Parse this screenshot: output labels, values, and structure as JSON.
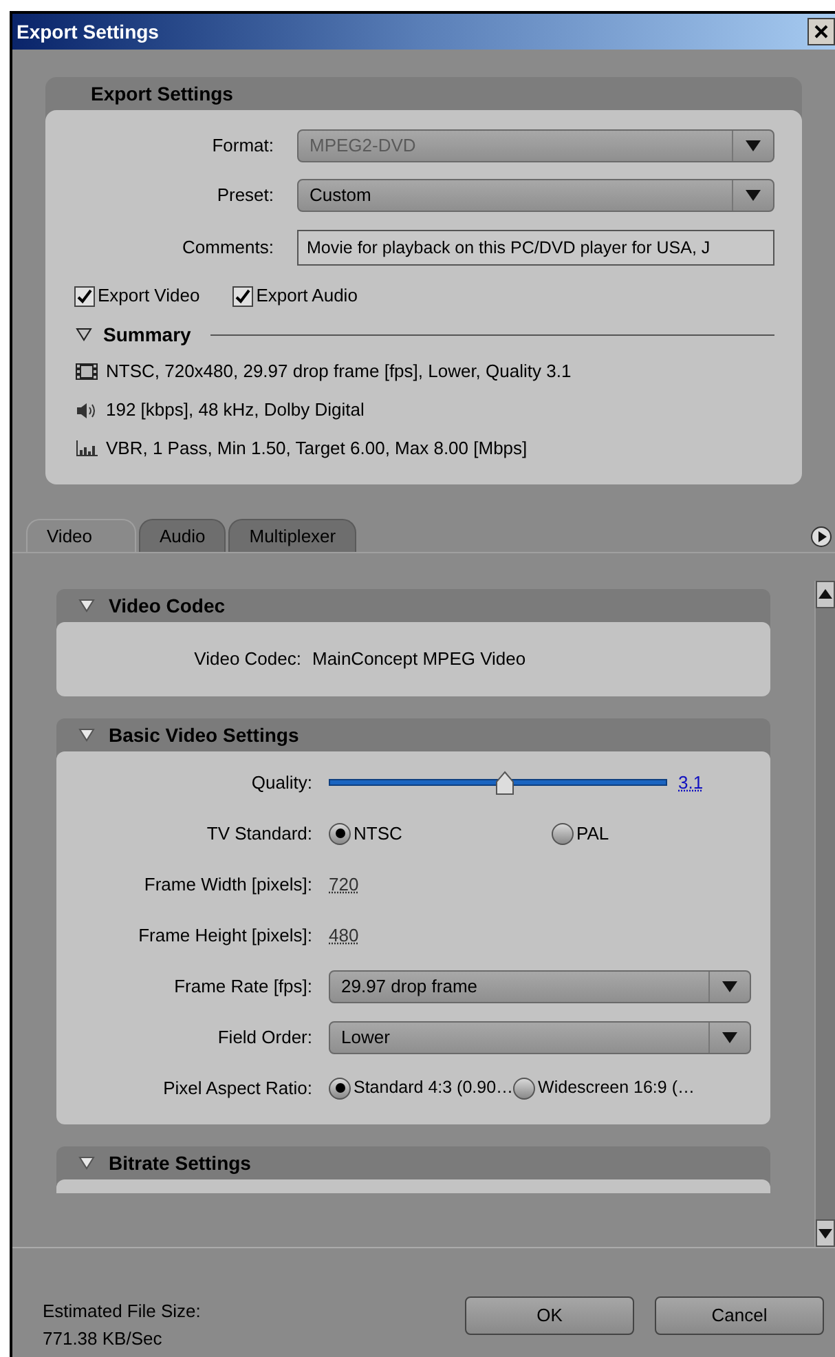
{
  "window": {
    "title": "Export Settings"
  },
  "export_settings": {
    "title": "Export Settings",
    "format": {
      "label": "Format:",
      "value": "MPEG2-DVD",
      "disabled": true
    },
    "preset": {
      "label": "Preset:",
      "value": "Custom",
      "disabled": false
    },
    "comments": {
      "label": "Comments:",
      "value": "Movie for playback on this PC/DVD player for USA, J"
    },
    "checkboxes": [
      {
        "label": "Export Video",
        "checked": true
      },
      {
        "label": "Export Audio",
        "checked": true
      }
    ],
    "summary": {
      "title": "Summary",
      "expanded": true,
      "lines": [
        {
          "kind": "video",
          "text": "NTSC, 720x480, 29.97 drop frame [fps], Lower, Quality 3.1"
        },
        {
          "kind": "audio",
          "text": "192 [kbps], 48 kHz, Dolby Digital"
        },
        {
          "kind": "bitrate",
          "text": "VBR, 1 Pass, Min 1.50, Target 6.00, Max 8.00 [Mbps]"
        }
      ]
    }
  },
  "tabs": [
    {
      "label": "Video",
      "selected": true
    },
    {
      "label": "Audio",
      "selected": false
    },
    {
      "label": "Multiplexer",
      "selected": false
    }
  ],
  "video_codec": {
    "title": "Video Codec",
    "expanded": true,
    "label": "Video Codec:",
    "value": "MainConcept MPEG Video"
  },
  "basic_video_settings": {
    "title": "Basic Video Settings",
    "expanded": true,
    "quality": {
      "label": "Quality:",
      "level": 0.52,
      "reading": "3.1"
    },
    "tv_standard": {
      "label": "TV Standard:",
      "options": [
        {
          "label": "NTSC",
          "selected": true
        },
        {
          "label": "PAL",
          "selected": false
        }
      ]
    },
    "frame_width": {
      "label": "Frame Width [pixels]:",
      "value": "720"
    },
    "frame_height": {
      "label": "Frame Height [pixels]:",
      "value": "480"
    },
    "frame_rate": {
      "label": "Frame Rate [fps]:",
      "value": "29.97 drop frame"
    },
    "field_order": {
      "label": "Field Order:",
      "value": "Lower"
    },
    "pixel_aspect_ratio": {
      "label": "Pixel Aspect Ratio:",
      "options": [
        {
          "label": "Standard 4:3 (0.90…",
          "selected": true
        },
        {
          "label": "Widescreen 16:9 (…",
          "selected": false
        }
      ]
    }
  },
  "bitrate_settings": {
    "title": "Bitrate Settings",
    "expanded": true
  },
  "footer": {
    "estimate_label": "Estimated File Size:",
    "estimate_value": "771.38 KB/Sec"
  },
  "buttons": [
    "OK",
    "Cancel"
  ]
}
